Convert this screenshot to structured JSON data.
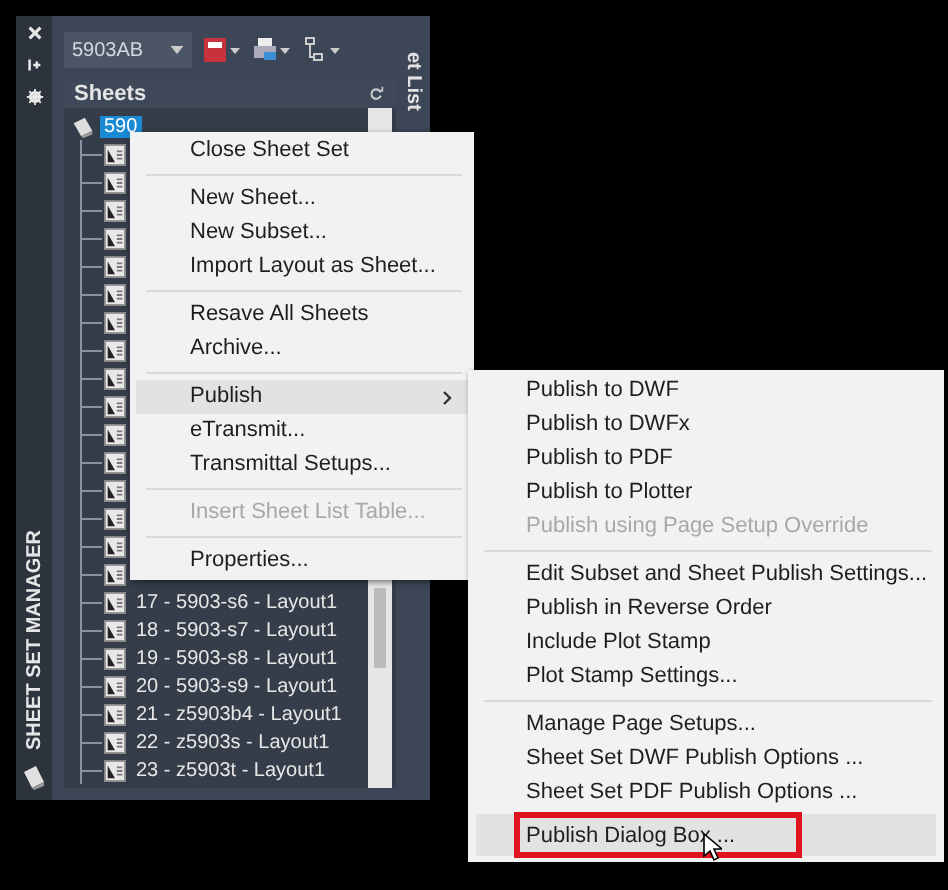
{
  "palette": {
    "title": "SHEET SET MANAGER",
    "sheet_set": "5903AB",
    "section": "Sheets",
    "side_tab": "et List",
    "tree": {
      "label": "590",
      "selected": true,
      "children": [
        {
          "kind": "sheet"
        },
        {
          "kind": "sheet"
        },
        {
          "kind": "sheet"
        },
        {
          "kind": "sheet"
        },
        {
          "kind": "sheet"
        },
        {
          "kind": "sheet"
        },
        {
          "kind": "sheet"
        },
        {
          "kind": "sheet"
        },
        {
          "kind": "sheet"
        },
        {
          "kind": "sheet"
        },
        {
          "kind": "sheet"
        },
        {
          "kind": "sheet"
        },
        {
          "kind": "sheet"
        },
        {
          "kind": "sheet"
        },
        {
          "kind": "sheet"
        },
        {
          "kind": "sheet"
        },
        {
          "kind": "sheet",
          "label": "17 - 5903-s6 - Layout1",
          "selected": false
        },
        {
          "kind": "sheet",
          "label": "18 - 5903-s7 - Layout1",
          "selected": false
        },
        {
          "kind": "sheet",
          "label": "19 - 5903-s8 - Layout1",
          "selected": false
        },
        {
          "kind": "sheet",
          "label": "20 - 5903-s9 - Layout1",
          "selected": false
        },
        {
          "kind": "sheet",
          "label": "21 - z5903b4 - Layout1",
          "selected": false
        },
        {
          "kind": "sheet",
          "label": "22 - z5903s - Layout1",
          "selected": false
        },
        {
          "kind": "sheet",
          "label": "23 - z5903t - Layout1",
          "selected": false
        }
      ]
    }
  },
  "context_menu": {
    "items": [
      {
        "kind": "item",
        "label": "Close Sheet Set",
        "disabled": false,
        "selected": false
      },
      {
        "kind": "separator"
      },
      {
        "kind": "item",
        "label": "New Sheet...",
        "disabled": false,
        "selected": false
      },
      {
        "kind": "item",
        "label": "New Subset...",
        "disabled": false,
        "selected": false
      },
      {
        "kind": "item",
        "label": "Import Layout as Sheet...",
        "disabled": false,
        "selected": false
      },
      {
        "kind": "separator"
      },
      {
        "kind": "item",
        "label": "Resave All Sheets",
        "disabled": false,
        "selected": false
      },
      {
        "kind": "item",
        "label": "Archive...",
        "disabled": false,
        "selected": false
      },
      {
        "kind": "separator"
      },
      {
        "kind": "item",
        "label": "Publish",
        "disabled": false,
        "selected": true,
        "has_submenu": true
      },
      {
        "kind": "item",
        "label": "eTransmit...",
        "disabled": false,
        "selected": false
      },
      {
        "kind": "item",
        "label": "Transmittal Setups...",
        "disabled": false,
        "selected": false
      },
      {
        "kind": "separator"
      },
      {
        "kind": "item",
        "label": "Insert Sheet List Table...",
        "disabled": true,
        "selected": false
      },
      {
        "kind": "separator"
      },
      {
        "kind": "item",
        "label": "Properties...",
        "disabled": false,
        "selected": false
      }
    ]
  },
  "submenu": {
    "items": [
      {
        "kind": "item",
        "label": "Publish to DWF",
        "disabled": false,
        "selected": false
      },
      {
        "kind": "item",
        "label": "Publish to DWFx",
        "disabled": false,
        "selected": false
      },
      {
        "kind": "item",
        "label": "Publish to PDF",
        "disabled": false,
        "selected": false
      },
      {
        "kind": "item",
        "label": "Publish to Plotter",
        "disabled": false,
        "selected": false
      },
      {
        "kind": "item",
        "label": "Publish using Page Setup Override",
        "disabled": true,
        "selected": false
      },
      {
        "kind": "separator"
      },
      {
        "kind": "item",
        "label": "Edit Subset and Sheet Publish Settings...",
        "disabled": false,
        "selected": false
      },
      {
        "kind": "item",
        "label": "Publish in Reverse Order",
        "disabled": false,
        "selected": false
      },
      {
        "kind": "item",
        "label": "Include Plot Stamp",
        "disabled": false,
        "selected": false
      },
      {
        "kind": "item",
        "label": "Plot Stamp Settings...",
        "disabled": false,
        "selected": false
      },
      {
        "kind": "separator"
      },
      {
        "kind": "item",
        "label": "Manage Page Setups...",
        "disabled": false,
        "selected": false
      },
      {
        "kind": "item",
        "label": "Sheet Set DWF Publish Options ...",
        "disabled": false,
        "selected": false
      },
      {
        "kind": "item",
        "label": "Sheet Set PDF Publish Options ...",
        "disabled": false,
        "selected": false
      },
      {
        "kind": "item",
        "label": "Publish Dialog Box ...",
        "disabled": false,
        "selected": true,
        "annotated": true
      }
    ]
  }
}
